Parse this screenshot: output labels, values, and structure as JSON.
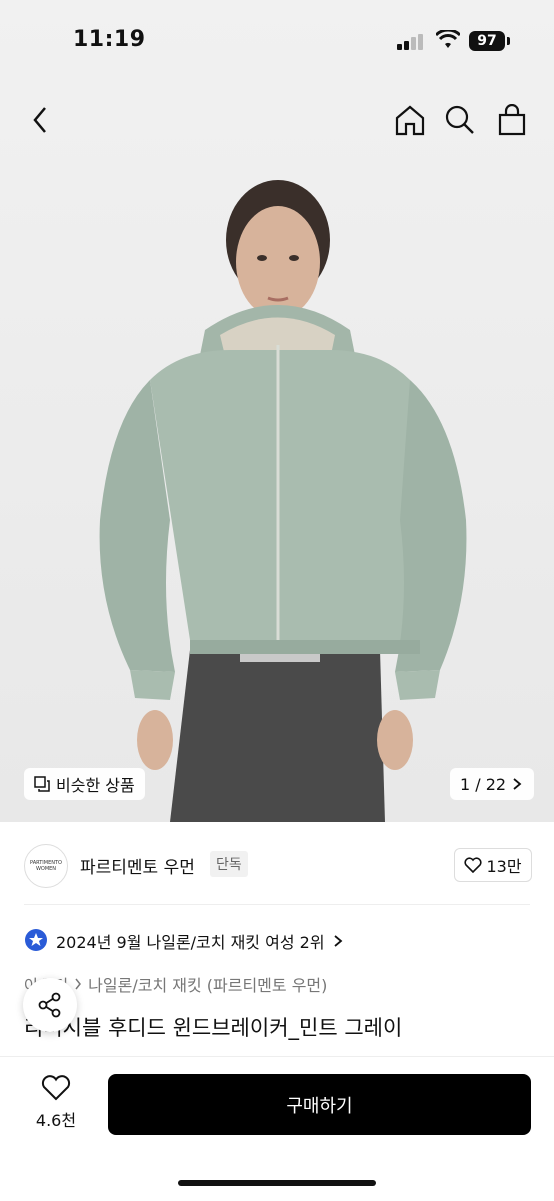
{
  "status": {
    "time": "11:19",
    "battery": "97"
  },
  "hero": {
    "similar_label": "비슷한 상품",
    "counter": "1 / 22"
  },
  "brand": {
    "logo_line1": "PARTIMENTO",
    "logo_line2": "WOMEN",
    "name": "파르티멘토 우먼",
    "tag": "단독",
    "likes": "13만"
  },
  "ranking": {
    "text": "2024년 9월 나일론/코치 재킷 여성 2위"
  },
  "breadcrumb": {
    "category": "아우터",
    "subcategory": "나일론/코치 재킷 (파르티멘토 우먼)"
  },
  "product": {
    "title": "리버시블 후디드 윈드브레이커_민트 그레이"
  },
  "bottom": {
    "wish_count": "4.6천",
    "buy_label": "구매하기"
  },
  "colors": {
    "jacket": "#a9bcaf",
    "pants": "#4a4a4a",
    "accent": "#2a5bd7"
  }
}
